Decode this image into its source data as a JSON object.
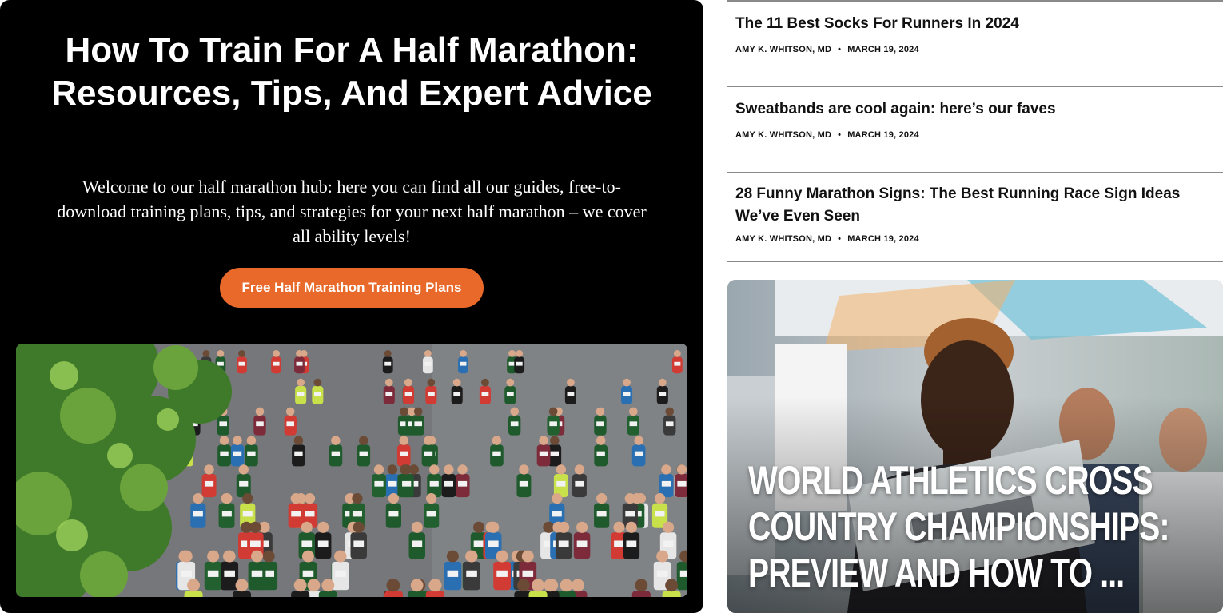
{
  "hero": {
    "title": "How To Train For A Half Marathon: Resources, Tips, And Expert Advice",
    "description": "Welcome to our half marathon hub: here you can find all our guides, free-to-download training plans, tips, and strategies for your next half marathon – we cover all ability levels!",
    "cta_label": "Free Half Marathon Training Plans",
    "accent_color": "#e8692a"
  },
  "articles": [
    {
      "title": "The 11 Best Socks For Runners In 2024",
      "author": "AMY K. WHITSON, MD",
      "separator": "•",
      "date": "MARCH 19, 2024"
    },
    {
      "title": "Sweatbands are cool again: here’s our faves",
      "author": "AMY K. WHITSON, MD",
      "separator": "•",
      "date": "MARCH 19, 2024"
    },
    {
      "title": "28 Funny Marathon Signs: The Best Running Race Sign Ideas We’ve Even Seen",
      "author": "AMY K. WHITSON, MD",
      "separator": "•",
      "date": "MARCH 19, 2024"
    }
  ],
  "feature": {
    "title": "WORLD ATHLETICS CROSS COUNTRY CHAMPIONSHIPS: PREVIEW AND HOW TO ..."
  }
}
